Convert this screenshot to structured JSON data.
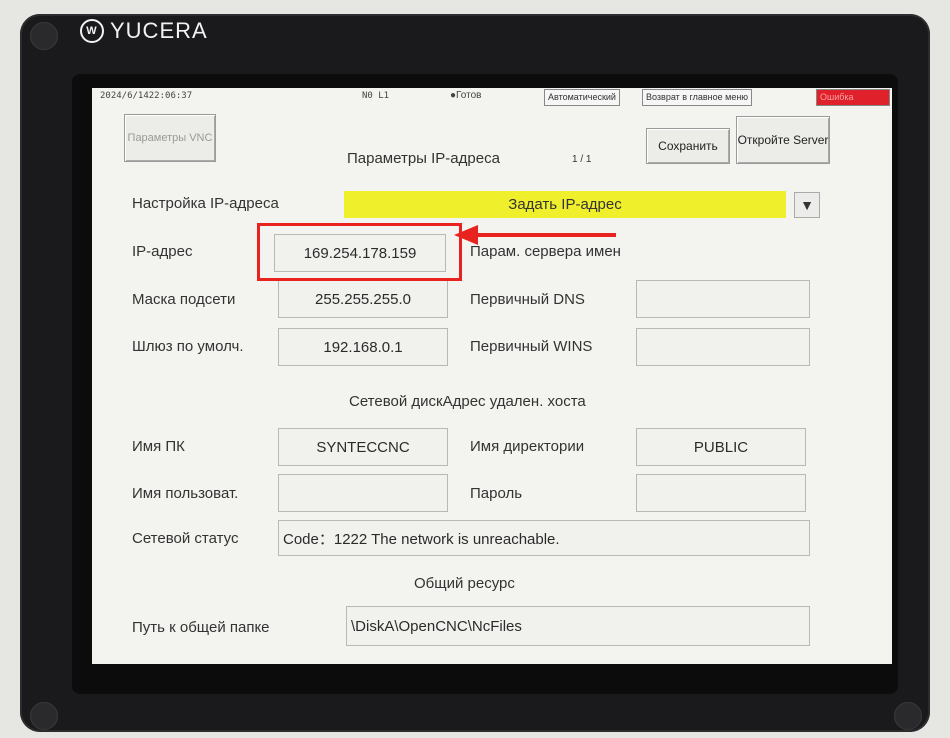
{
  "device": {
    "brand": "YUCERA"
  },
  "statusbar": {
    "datetime": "2024/6/1422:06:37",
    "program": "N0 L1",
    "ready": "Готов",
    "mode": "Автоматический",
    "return_main": "Возврат в главное меню",
    "error": "Ошибка"
  },
  "toolbar": {
    "vnc_button": "Параметры VNC",
    "title": "Параметры IP-адреса",
    "page": "1 / 1",
    "save_button": "Сохранить",
    "open_server_button": "Откройте Server"
  },
  "ip_setting": {
    "label": "Настройка IP-адреса",
    "value": "Задать IP-адрес"
  },
  "network": {
    "ip_label": "IP-адрес",
    "ip_value": "169.254.178.159",
    "mask_label": "Маска подсети",
    "mask_value": "255.255.255.0",
    "gateway_label": "Шлюз по умолч.",
    "gateway_value": "192.168.0.1",
    "dns_section": "Парам. сервера имен",
    "dns_label": "Первичный DNS",
    "dns_value": "",
    "wins_label": "Первичный WINS",
    "wins_value": ""
  },
  "netdisk": {
    "section": "Сетевой дискАдрес удален. хоста",
    "pc_label": "Имя ПК",
    "pc_value": "SYNTECCNC",
    "dir_label": "Имя директории",
    "dir_value": "PUBLIC",
    "user_label": "Имя пользоват.",
    "user_value": "",
    "password_label": "Пароль",
    "password_value": "",
    "status_label": "Сетевой статус",
    "status_value": "Code：1222 The network is unreachable."
  },
  "share": {
    "section": "Общий ресурс",
    "path_label": "Путь к общей папке",
    "path_value": "\\DiskA\\OpenCNC\\NcFiles"
  },
  "colors": {
    "highlight": "#e8231f",
    "yellow_bar": "#f0ef2c",
    "error": "#e0202a"
  }
}
